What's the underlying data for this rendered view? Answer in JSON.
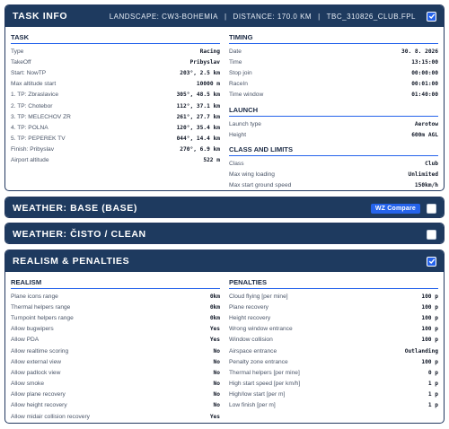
{
  "task_info": {
    "title": "TASK INFO",
    "landscape": "LANDSCAPE: CW3-BOHEMIA",
    "distance": "DISTANCE: 170.0 KM",
    "file": "TBC_310826_CLUB.FPL",
    "separator": "|",
    "checked": true,
    "task": {
      "title": "TASK",
      "rows": [
        {
          "label": "Type",
          "value": "Racing"
        },
        {
          "label": "TakeOff",
          "value": "Pribyslav"
        },
        {
          "label": "Start: NowTP",
          "value": "203°, 2.5 km"
        },
        {
          "label": "Max altitude start",
          "value": "10000 m"
        },
        {
          "label": "1. TP: Zbraslavice",
          "value": "305°, 48.5 km"
        },
        {
          "label": "2. TP: Chotebor",
          "value": "112°, 37.1 km"
        },
        {
          "label": "3. TP: MELECHOV ZR",
          "value": "261°, 27.7 km"
        },
        {
          "label": "4. TP: POLNA",
          "value": "120°, 35.4 km"
        },
        {
          "label": "5. TP: PEPEREK TV",
          "value": "044°, 14.4 km"
        },
        {
          "label": "Finish: Pribyslav",
          "value": "270°, 6.9 km"
        },
        {
          "label": "Airport altitude",
          "value": "522 m"
        }
      ]
    },
    "timing": {
      "title": "TIMING",
      "rows": [
        {
          "label": "Date",
          "value": "30. 8. 2026"
        },
        {
          "label": "Time",
          "value": "13:15:00"
        },
        {
          "label": "Stop join",
          "value": "00:00:00"
        },
        {
          "label": "RaceIn",
          "value": "00:01:00"
        },
        {
          "label": "Time window",
          "value": "01:40:00"
        }
      ]
    },
    "launch": {
      "title": "LAUNCH",
      "rows": [
        {
          "label": "Launch type",
          "value": "Aerotow"
        },
        {
          "label": "Height",
          "value": "600m AGL"
        }
      ]
    },
    "class_limits": {
      "title": "CLASS AND LIMITS",
      "rows": [
        {
          "label": "Class",
          "value": "Club"
        },
        {
          "label": "Max wing loading",
          "value": "Unlimited"
        },
        {
          "label": "Max start ground speed",
          "value": "150km/h"
        }
      ]
    }
  },
  "weather_base": {
    "title": "WEATHER: BASE (BASE)",
    "button_label": "WZ Compare",
    "checked": false
  },
  "weather_clean": {
    "title": "WEATHER: ČISTO / CLEAN",
    "checked": false
  },
  "realism_penalties": {
    "title": "REALISM & PENALTIES",
    "checked": true,
    "realism": {
      "title": "REALISM",
      "rows": [
        {
          "label": "Plane icons range",
          "value": "0km"
        },
        {
          "label": "Thermal helpers range",
          "value": "0km"
        },
        {
          "label": "Turnpoint helpers range",
          "value": "0km"
        },
        {
          "label": "Allow bugwipers",
          "value": "Yes"
        },
        {
          "label": "Allow PDA",
          "value": "Yes"
        },
        {
          "label": "Allow realtime scoring",
          "value": "No"
        },
        {
          "label": "Allow external view",
          "value": "No"
        },
        {
          "label": "Allow padlock view",
          "value": "No"
        },
        {
          "label": "Allow smoke",
          "value": "No"
        },
        {
          "label": "Allow plane recovery",
          "value": "No"
        },
        {
          "label": "Allow height recovery",
          "value": "No"
        },
        {
          "label": "Allow midair collision recovery",
          "value": "Yes"
        }
      ]
    },
    "penalties": {
      "title": "PENALTIES",
      "rows": [
        {
          "label": "Cloud flying [per mine]",
          "value": "100 p"
        },
        {
          "label": "Plane recovery",
          "value": "100 p"
        },
        {
          "label": "Height recovery",
          "value": "100 p"
        },
        {
          "label": "Wrong window entrance",
          "value": "100 p"
        },
        {
          "label": "Window collision",
          "value": "100 p"
        },
        {
          "label": "Airspace entrance",
          "value": "Outlanding"
        },
        {
          "label": "Penalty zone entrance",
          "value": "100 p"
        },
        {
          "label": "Thermal helpers [per mine]",
          "value": "0 p"
        },
        {
          "label": "High start speed [per km/h]",
          "value": "1 p"
        },
        {
          "label": "High/low start [per m]",
          "value": "1 p"
        },
        {
          "label": "Low finish [per m]",
          "value": "1 p"
        }
      ]
    }
  }
}
